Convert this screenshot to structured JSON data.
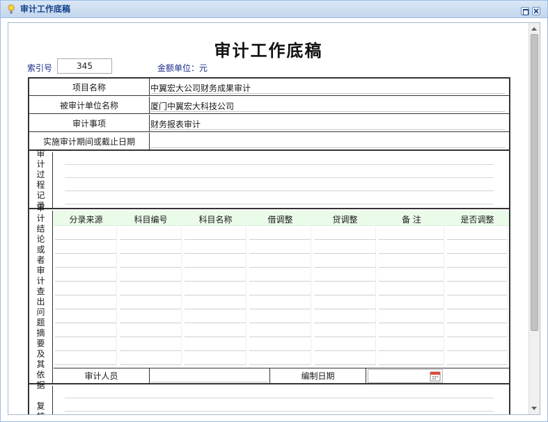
{
  "window": {
    "title": "审计工作底稿",
    "icon": "lightbulb-icon",
    "buttons": [
      "maximize-icon",
      "close-icon"
    ]
  },
  "doc": {
    "title": "审计工作底稿",
    "index_label": "索引号",
    "index_value": "345",
    "unit_label": "金额单位：元"
  },
  "fields": [
    {
      "label": "项目名称",
      "value": "中翼宏大公司财务成果审计"
    },
    {
      "label": "被审计单位名称",
      "value": "厦门中翼宏大科技公司"
    },
    {
      "label": "审计事项",
      "value": "财务报表审计"
    },
    {
      "label": "实施审计期间或截止日期",
      "value": ""
    }
  ],
  "sections": {
    "process": "审计过程记录",
    "conclusion": "审计结论或者审计查出问题摘要及其依据",
    "review": "复核"
  },
  "grid": {
    "columns": [
      "分录来源",
      "科目编号",
      "科目名称",
      "借调整",
      "贷调整",
      "备 注",
      "是否调整"
    ],
    "empty_rows": 10
  },
  "signoff": {
    "auditor_label": "审计人员",
    "auditor_value": "",
    "date_label": "编制日期",
    "date_value": "",
    "date_icon": "calendar-icon"
  },
  "colors": {
    "title_bar": "#c4d7ee",
    "title_text": "#15428b",
    "label_blue": "#1c2f8c",
    "grid_header": "#eafbea"
  }
}
